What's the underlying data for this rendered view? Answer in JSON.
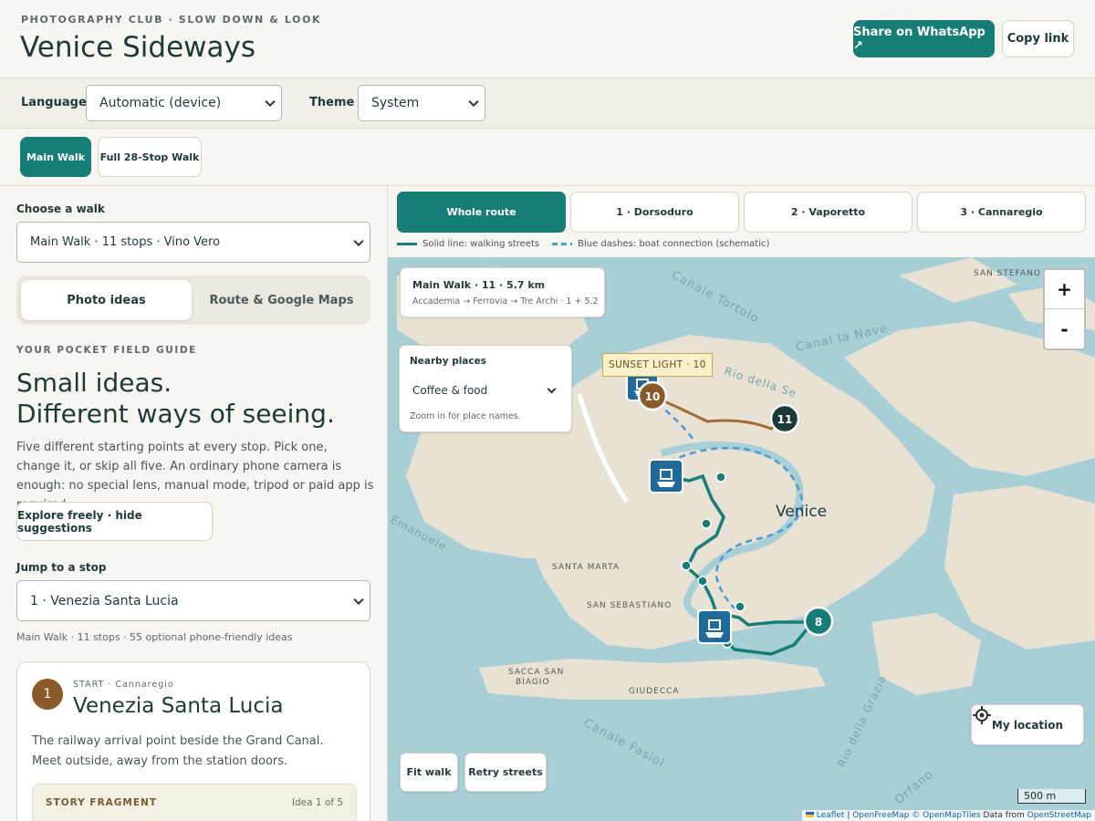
{
  "header": {
    "eyebrow": "PHOTOGRAPHY CLUB · SLOW DOWN & LOOK",
    "title": "Venice Sideways",
    "share_label": "Share on WhatsApp ↗",
    "copy_label": "Copy link"
  },
  "settings": {
    "language_label": "Language",
    "language_value": "Automatic (device)",
    "theme_label": "Theme",
    "theme_value": "System"
  },
  "walk_toggle": {
    "main": "Main Walk",
    "full": "Full 28-Stop Walk"
  },
  "left": {
    "choose_label": "Choose a walk",
    "choose_value": "Main Walk · 11 stops · Vino Vero",
    "seg_photo": "Photo ideas",
    "seg_route": "Route & Google Maps",
    "guide_eyebrow": "YOUR POCKET FIELD GUIDE",
    "guide_title_1": "Small ideas.",
    "guide_title_2": "Different ways of seeing.",
    "guide_body": "Five different starting points at every stop. Pick one, change it, or skip all five. An ordinary phone camera is enough: no special lens, manual mode, tripod or paid app is required.",
    "explore_label": "Explore freely · hide suggestions",
    "jump_label": "Jump to a stop",
    "jump_value": "1 · Venezia Santa Lucia",
    "meta": "Main Walk · 11 stops · 55 optional phone-friendly ideas"
  },
  "stop_card": {
    "number": "1",
    "eyebrow": "START · Cannaregio",
    "title": "Venezia Santa Lucia",
    "description": "The railway arrival point beside the Grand Canal. Meet outside, away from the station doors.",
    "story_label": "STORY FRAGMENT",
    "idea_count": "Idea 1 of 5"
  },
  "map_tabs": [
    "Whole route",
    "1 · Dorsoduro",
    "2 · Vaporetto",
    "3 · Cannaregio"
  ],
  "legend": {
    "solid": "Solid line: walking streets",
    "dashed": "Blue dashes: boat connection (schematic)"
  },
  "map": {
    "info_title": "Main Walk · 11 · 5.7 km",
    "info_sub": "Accademia → Ferrovia → Tre Archi · 1 + 5.2",
    "nearby_label": "Nearby places",
    "nearby_value": "Coffee & food",
    "nearby_hint": "Zoom in for place names.",
    "sunset_label": "SUNSET LIGHT · 10",
    "zoom_in": "+",
    "zoom_out": "-",
    "my_location": "My location",
    "fit_walk": "Fit walk",
    "retry_streets": "Retry streets",
    "scale": "500 m",
    "attrib_leaflet": "Leaflet",
    "attrib_sep": " | ",
    "attrib_ofm": "OpenFreeMap",
    "attrib_omt": "© OpenMapTiles",
    "attrib_data": " Data from ",
    "attrib_osm": "OpenStreetMap",
    "labels": {
      "venice": "Venice",
      "santa_marta": "SANTA MARTA",
      "san_sebastiano": "SAN SEBASTIANO",
      "sacca_san": "SACCA SAN",
      "biagio": "BIAGIO",
      "giudecca": "GIUDECCA",
      "san_stefano": "SAN STEFANO",
      "canale_tortolo": "Canale Tortolo",
      "canal_la_nave": "Canal la Nave",
      "rio_della_se": "Rio della Se",
      "emanuele": "Emanuele",
      "canale_fasiol": "Canale Fasiol",
      "rio_della_grazia": "Rio della Grazia",
      "orfano": "Orfano"
    },
    "markers": [
      "10",
      "11",
      "8"
    ]
  },
  "colors": {
    "teal": "#167d77",
    "brown": "#8a5a2b",
    "boat_dash": "#4a9ad6",
    "water": "#a8cfd6",
    "land": "#e8e2d4"
  }
}
